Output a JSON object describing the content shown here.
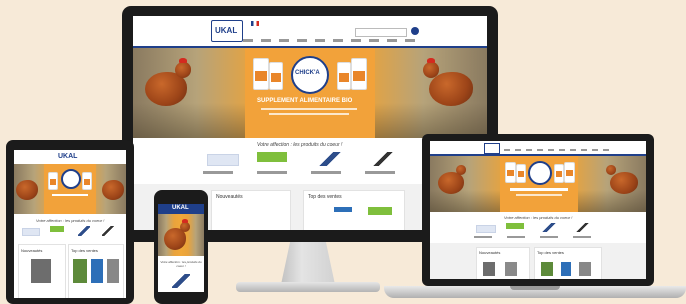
{
  "brand": {
    "logo_text": "UKAL"
  },
  "hero": {
    "badge_text": "CHICK'A",
    "title": "SUPPLEMENT ALIMENTAIRE BIO"
  },
  "section": {
    "title": "Votre affection : les produits du coeur !"
  },
  "blocks": {
    "nouveautes": "Nouveautés",
    "top_ventes": "Top des ventes"
  },
  "phone": {
    "section_title": "Votre affection : les produits du coeur !"
  },
  "colors": {
    "nav": "#1f3f8a",
    "hero_orange": "#f0a83a",
    "accent_green": "#7fbf3c",
    "accent_blue": "#2d6fb8",
    "background": "#f7ead8"
  }
}
